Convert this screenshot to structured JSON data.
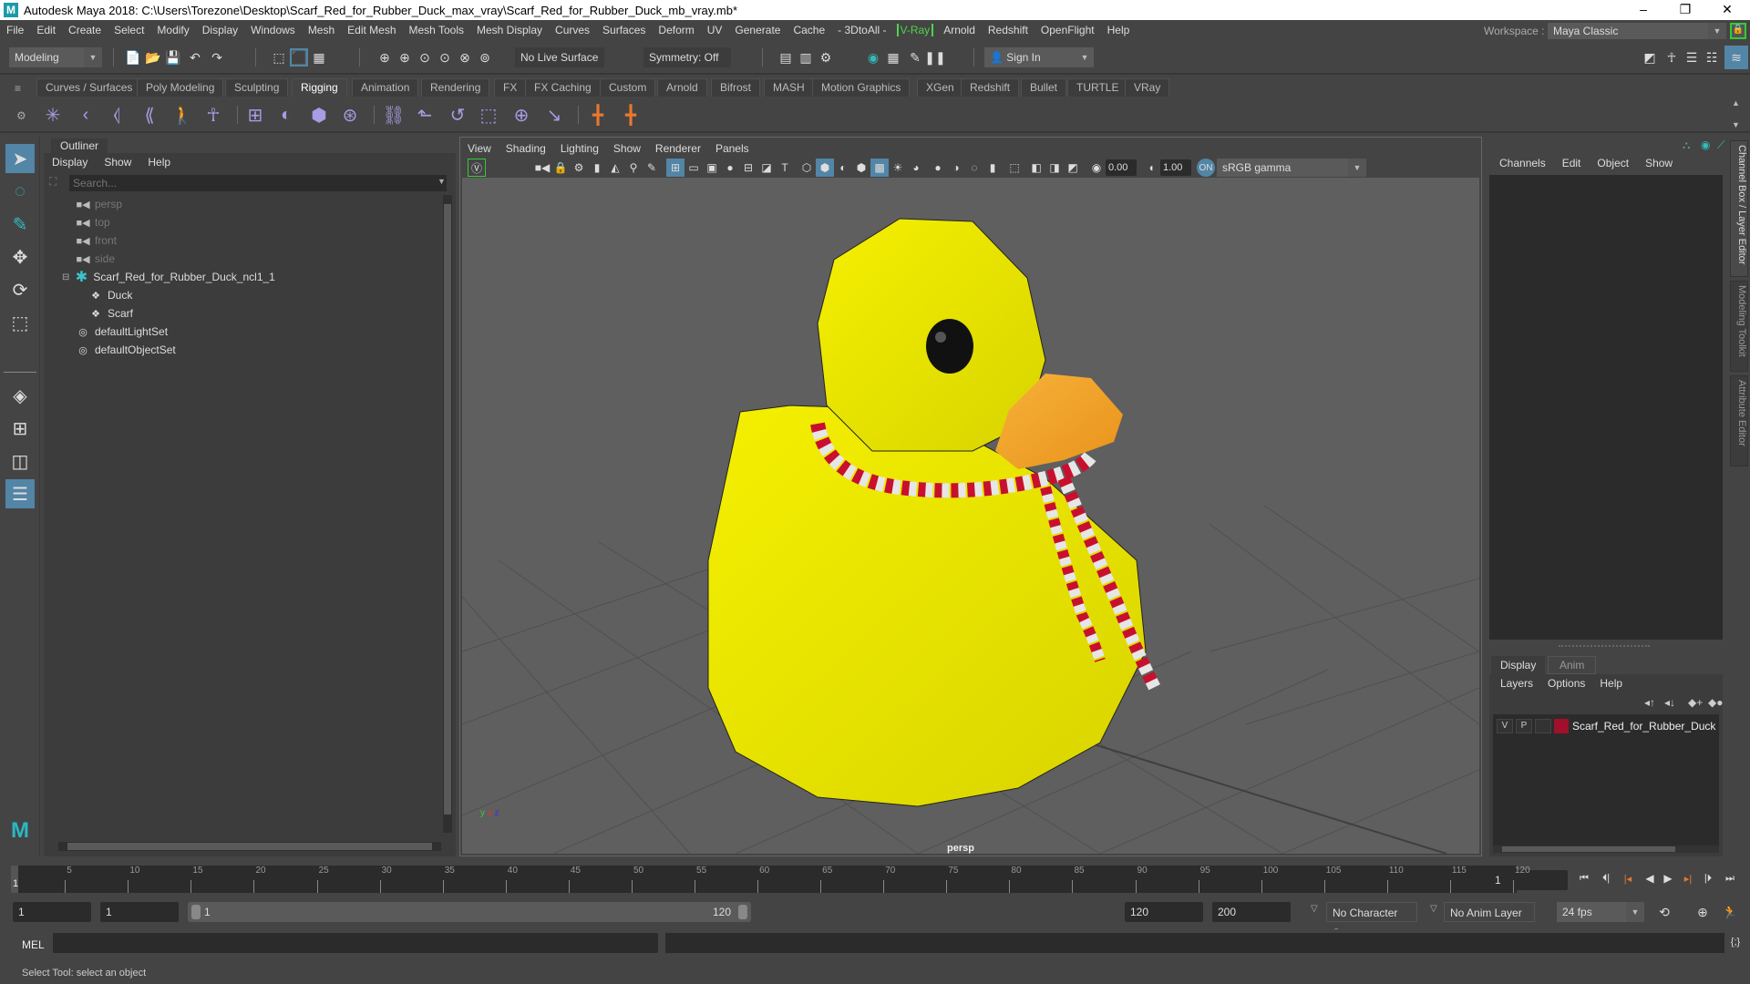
{
  "window": {
    "title": "Autodesk Maya 2018: C:\\Users\\Torezone\\Desktop\\Scarf_Red_for_Rubber_Duck_max_vray\\Scarf_Red_for_Rubber_Duck_mb_vray.mb*",
    "minimize": "–",
    "maximize": "❐",
    "close": "✕"
  },
  "menubar": {
    "items": [
      "File",
      "Edit",
      "Create",
      "Select",
      "Modify",
      "Display",
      "Windows",
      "Mesh",
      "Edit Mesh",
      "Mesh Tools",
      "Mesh Display",
      "Curves",
      "Surfaces",
      "Deform",
      "UV",
      "Generate",
      "Cache",
      "- 3DtoAll -",
      "V-Ray",
      "Arnold",
      "Redshift",
      "OpenFlight",
      "Help"
    ],
    "workspace_label": "Workspace :",
    "workspace_value": "Maya Classic"
  },
  "statusline": {
    "mode": "Modeling",
    "live_surface": "No Live Surface",
    "symmetry": "Symmetry: Off",
    "sign_in": "Sign In"
  },
  "shelf": {
    "tabs": [
      "Curves / Surfaces",
      "Poly Modeling",
      "Sculpting",
      "Rigging",
      "Animation",
      "Rendering",
      "FX",
      "FX Caching",
      "Custom",
      "Arnold",
      "Bifrost",
      "MASH",
      "Motion Graphics",
      "XGen",
      "Redshift",
      "Bullet",
      "TURTLE",
      "VRay"
    ],
    "active_tab": "Rigging"
  },
  "outliner": {
    "title": "Outliner",
    "menu": [
      "Display",
      "Show",
      "Help"
    ],
    "search_placeholder": "Search...",
    "items": [
      {
        "label": "persp",
        "icon": "camera-icon",
        "dim": true,
        "indent": 1
      },
      {
        "label": "top",
        "icon": "camera-icon",
        "dim": true,
        "indent": 1
      },
      {
        "label": "front",
        "icon": "camera-icon",
        "dim": true,
        "indent": 1
      },
      {
        "label": "side",
        "icon": "camera-icon",
        "dim": true,
        "indent": 1
      },
      {
        "label": "Scarf_Red_for_Rubber_Duck_ncl1_1",
        "icon": "group-icon",
        "dim": false,
        "indent": 0,
        "expanded": true
      },
      {
        "label": "Duck",
        "icon": "mesh-icon",
        "dim": false,
        "indent": 2
      },
      {
        "label": "Scarf",
        "icon": "mesh-icon",
        "dim": false,
        "indent": 2
      },
      {
        "label": "defaultLightSet",
        "icon": "set-icon",
        "dim": false,
        "indent": 1
      },
      {
        "label": "defaultObjectSet",
        "icon": "set-icon",
        "dim": false,
        "indent": 1
      }
    ]
  },
  "viewport": {
    "menu": [
      "View",
      "Shading",
      "Lighting",
      "Show",
      "Renderer",
      "Panels"
    ],
    "exposure": "0.00",
    "gamma": "1.00",
    "color_space": "sRGB gamma",
    "camera_label": "persp",
    "axis": {
      "x": "x",
      "y": "y",
      "z": "z"
    }
  },
  "channelbox": {
    "menu": [
      "Channels",
      "Edit",
      "Object",
      "Show"
    ]
  },
  "layereditor": {
    "tabs": [
      "Display",
      "Anim"
    ],
    "active_tab": "Display",
    "menu": [
      "Layers",
      "Options",
      "Help"
    ],
    "layers": [
      {
        "v": "V",
        "p": "P",
        "name": "Scarf_Red_for_Rubber_Duck",
        "color": "#a0102a"
      }
    ]
  },
  "side_tabs": [
    "Channel Box / Layer Editor",
    "Modeling Toolkit",
    "Attribute Editor"
  ],
  "timeline": {
    "ticks": [
      5,
      10,
      15,
      20,
      25,
      30,
      35,
      40,
      45,
      50,
      55,
      60,
      65,
      70,
      75,
      80,
      85,
      90,
      95,
      100,
      105,
      110,
      115,
      120
    ],
    "current_frame_marker": "1",
    "current_frame": "1",
    "range_start": "1",
    "playback_start": "1",
    "slider_start": "1",
    "slider_end": "120",
    "playback_end": "120",
    "range_end": "200",
    "character_set": "No Character Set",
    "anim_layer": "No Anim Layer",
    "fps": "24 fps"
  },
  "commandline": {
    "label": "MEL"
  },
  "helpline": {
    "text": "Select Tool: select an object"
  }
}
